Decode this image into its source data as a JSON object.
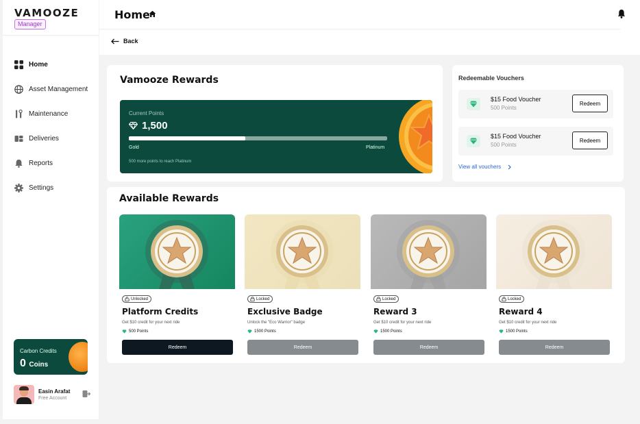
{
  "sidebar": {
    "logo": "VAMOOZE",
    "role": "Manager",
    "items": [
      {
        "label": "Home",
        "icon": "grid-icon"
      },
      {
        "label": "Asset Management",
        "icon": "globe-icon"
      },
      {
        "label": "Maintenance",
        "icon": "tools-icon"
      },
      {
        "label": "Deliveries",
        "icon": "truck-icon"
      },
      {
        "label": "Reports",
        "icon": "bell-icon"
      },
      {
        "label": "Settings",
        "icon": "gear-icon"
      }
    ],
    "carbon": {
      "label": "Carbon Credits",
      "value": "0",
      "unit": "Coins"
    },
    "user": {
      "name": "Easin Arafat",
      "account": "Free Account"
    }
  },
  "header": {
    "title": "Home",
    "back": "Back"
  },
  "rewards": {
    "title": "Vamooze Rewards",
    "current_label": "Current Points",
    "points": "1,500",
    "progress_fraction": 0.45,
    "level_from": "Gold",
    "level_to": "Platinum",
    "note": "500 more points to reach Platinum"
  },
  "vouchers": {
    "title": "Redeemable Vouchers",
    "items": [
      {
        "name": "$15 Food Voucher",
        "points": "500 Points",
        "button": "Redeem"
      },
      {
        "name": "$15 Food Voucher",
        "points": "500 Points",
        "button": "Redeem"
      }
    ],
    "view_all": "View all vouchers"
  },
  "available": {
    "title": "Available Rewards",
    "items": [
      {
        "status": "Unlocked",
        "name": "Platform Credits",
        "desc": "Get $10 credit for your next ride",
        "points": "500 Points",
        "button": "Redeem"
      },
      {
        "status": "Locked",
        "name": "Exclusive Badge",
        "desc": "Unlock the \"Eco Warrior\" badge",
        "points": "1500 Points",
        "button": "Redeem"
      },
      {
        "status": "Locked",
        "name": "Reward 3",
        "desc": "Get $10 credit for your next ride",
        "points": "1500 Points",
        "button": "Redeem"
      },
      {
        "status": "Locked",
        "name": "Reward 4",
        "desc": "Get $10 credit for your next ride",
        "points": "1500 Points",
        "button": "Redeem"
      }
    ]
  },
  "colors": {
    "brand_green": "#0b4a3c",
    "accent_orange": "#f08a1c",
    "link": "#2b67d9",
    "button_dark": "#0d1820",
    "button_disabled": "#868b8f"
  }
}
